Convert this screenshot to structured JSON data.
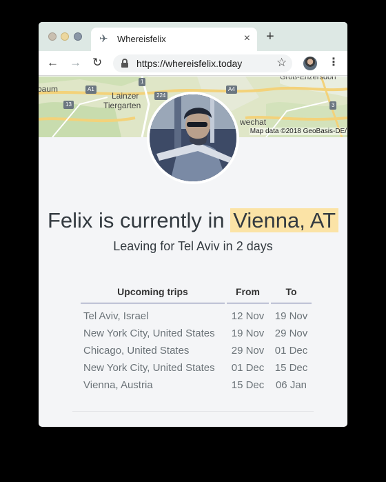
{
  "browser": {
    "tab_title": "Whereisfelix",
    "url": "https://whereisfelix.today",
    "icons": [
      "airplane-icon",
      "close-icon",
      "plus-icon",
      "back-icon",
      "forward-icon",
      "reload-icon",
      "lock-icon",
      "star-icon",
      "menu-icon"
    ]
  },
  "map": {
    "labels": [
      "baum",
      "Lainzer",
      "Tiergarten",
      "wechat",
      "Groß-Enzersdorf"
    ],
    "road_badges": [
      "A1",
      "13",
      "1",
      "224",
      "A4",
      "3"
    ],
    "attribution": "Map data ©2018 GeoBasis-DE/"
  },
  "headline": {
    "prefix": "Felix is currently in ",
    "location": "Vienna, AT"
  },
  "subline": "Leaving for Tel Aviv in 2 days",
  "trips": {
    "headers": [
      "Upcoming trips",
      "From",
      "To"
    ],
    "rows": [
      [
        "Tel Aviv, Israel",
        "12 Nov",
        "19 Nov"
      ],
      [
        "New York City, United States",
        "19 Nov",
        "29 Nov"
      ],
      [
        "Chicago, United States",
        "29 Nov",
        "01 Dec"
      ],
      [
        "New York City, United States",
        "01 Dec",
        "15 Dec"
      ],
      [
        "Vienna, Austria",
        "15 Dec",
        "06 Jan"
      ]
    ]
  },
  "colors": {
    "highlight": "#fbe3a6",
    "header_rule": "#5e6798",
    "text": "#333a40"
  }
}
